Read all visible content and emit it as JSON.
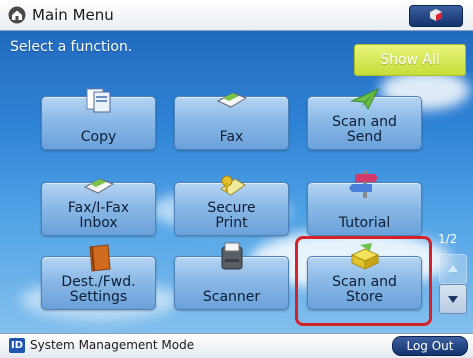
{
  "header": {
    "title": "Main Menu"
  },
  "subheader": {
    "prompt": "Select a function.",
    "show_all_label": "Show All"
  },
  "functions": [
    {
      "label_lines": [
        "Copy"
      ],
      "icon": "copy-icon"
    },
    {
      "label_lines": [
        "Fax"
      ],
      "icon": "fax-icon"
    },
    {
      "label_lines": [
        "Scan and",
        "Send"
      ],
      "icon": "scan-send-icon"
    },
    {
      "label_lines": [
        "Fax/I-Fax",
        "Inbox"
      ],
      "icon": "fax-inbox-icon"
    },
    {
      "label_lines": [
        "Secure",
        "Print"
      ],
      "icon": "secure-print-icon"
    },
    {
      "label_lines": [
        "Tutorial"
      ],
      "icon": "tutorial-icon"
    },
    {
      "label_lines": [
        "Dest./Fwd.",
        "Settings"
      ],
      "icon": "address-book-icon"
    },
    {
      "label_lines": [
        "Scanner"
      ],
      "icon": "scanner-icon"
    },
    {
      "label_lines": [
        "Scan and",
        "Store"
      ],
      "icon": "scan-store-icon"
    }
  ],
  "pager": {
    "indicator": "1/2"
  },
  "footer": {
    "id_badge": "ID",
    "system_mode": "System Management Mode",
    "logout_label": "Log Out"
  },
  "colors": {
    "highlight": "#d3222a",
    "show_all": "#d4e85a",
    "nav_button": "#1f3f7c"
  }
}
